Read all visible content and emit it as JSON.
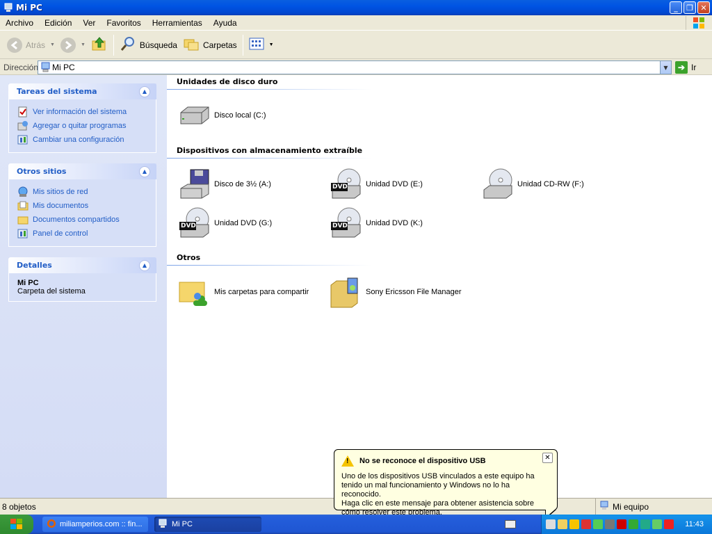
{
  "window": {
    "title": "Mi PC"
  },
  "menu": [
    "Archivo",
    "Edición",
    "Ver",
    "Favoritos",
    "Herramientas",
    "Ayuda"
  ],
  "toolbar": {
    "back_label": "Atrás",
    "search_label": "Búsqueda",
    "folders_label": "Carpetas"
  },
  "address": {
    "label": "Dirección",
    "value": "Mi PC",
    "go_label": "Ir"
  },
  "sidebar": {
    "system_tasks": {
      "title": "Tareas del sistema",
      "items": [
        "Ver información del sistema",
        "Agregar o quitar programas",
        "Cambiar una configuración"
      ]
    },
    "other_places": {
      "title": "Otros sitios",
      "items": [
        "Mis sitios de red",
        "Mis documentos",
        "Documentos compartidos",
        "Panel de control"
      ]
    },
    "details": {
      "title": "Detalles",
      "name": "Mi PC",
      "type": "Carpeta del sistema"
    }
  },
  "groups": {
    "hard_disks": {
      "title": "Unidades de disco duro",
      "items": [
        "Disco local (C:)"
      ]
    },
    "removable": {
      "title": "Dispositivos con almacenamiento extraíble",
      "items": [
        "Disco de 3½ (A:)",
        "Unidad DVD (E:)",
        "Unidad CD-RW (F:)",
        "Unidad DVD (G:)",
        "Unidad DVD (K:)"
      ]
    },
    "others": {
      "title": "Otros",
      "items": [
        "Mis carpetas para compartir",
        "Sony Ericsson File Manager"
      ]
    }
  },
  "dvd_badge": "DVD",
  "status": {
    "left": "8 objetos",
    "right": "Mi equipo"
  },
  "balloon": {
    "title": "No se reconoce el dispositivo USB",
    "body1": "Uno de los dispositivos USB vinculados a este equipo ha tenido un mal funcionamiento y Windows no lo ha reconocido.",
    "body2": "Haga clic en este mensaje para obtener asistencia sobre cómo resolver este problema."
  },
  "taskbar": {
    "items": [
      "miliamperios.com :: fin...",
      "Mi PC"
    ],
    "clock": "11:43"
  }
}
